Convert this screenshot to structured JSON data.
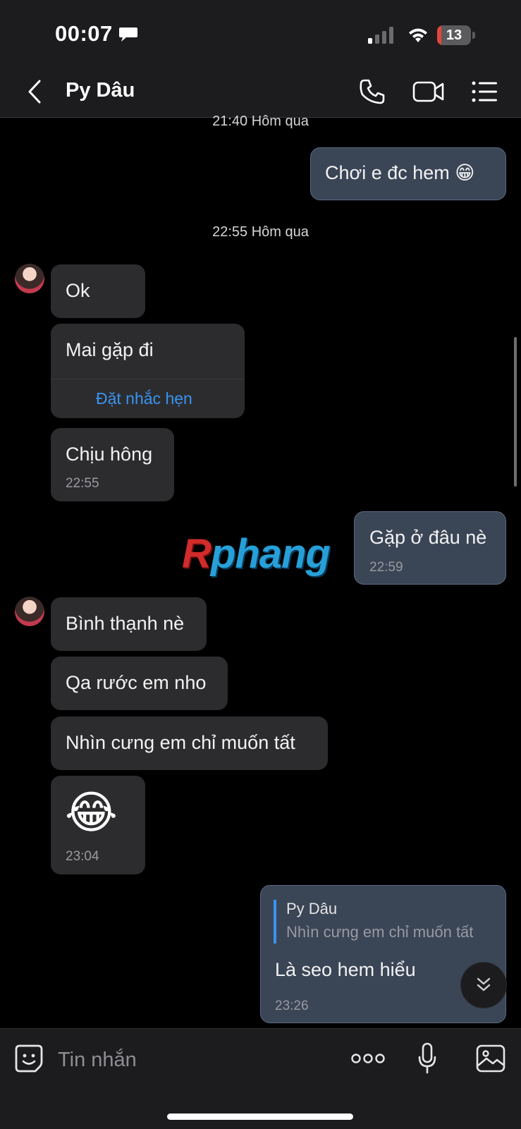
{
  "status_bar": {
    "time": "00:07",
    "battery_level": "13",
    "battery_fraction": 0.13,
    "battery_color": "#e5453a",
    "icons": [
      "chat-bubble-icon",
      "cellular-signal-icon",
      "wifi-icon",
      "battery-icon"
    ]
  },
  "header": {
    "contact_name": "Py Dâu",
    "icons": [
      "back-chevron-icon",
      "phone-icon",
      "video-call-icon",
      "list-menu-icon"
    ]
  },
  "messages": {
    "ts1": "21:40 Hôm qua",
    "m1_text": "Chơi e đc hem 😁",
    "ts2": "22:55 Hôm qua",
    "m2_text": "Ok",
    "m3_text": "Mai gặp đi",
    "m3_action": "Đặt nhắc hẹn",
    "m4_text": "Chịu hông",
    "m4_time": "22:55",
    "m5_text": "Gặp ở đâu nè",
    "m5_time": "22:59",
    "m6_text": "Bình thạnh nè",
    "m7_text": "Qa rước em nho",
    "m8_text": "Nhìn cưng em chỉ muốn tất",
    "m9_emoji": "😂",
    "m9_time": "23:04",
    "m10_quote_name": "Py Dâu",
    "m10_quote_text": "Nhìn cưng em chỉ muốn tất",
    "m10_text": "Là seo hem hiểu",
    "m10_time": "23:26"
  },
  "watermark": {
    "first": "R",
    "rest": "phang"
  },
  "composer": {
    "placeholder": "Tin nhắn",
    "icons": [
      "sticker-icon",
      "more-options-icon",
      "microphone-icon",
      "gallery-icon"
    ]
  },
  "colors": {
    "accent": "#3a93f0",
    "incoming_bubble": "#2c2c2e",
    "outgoing_bubble": "#3a4556"
  }
}
